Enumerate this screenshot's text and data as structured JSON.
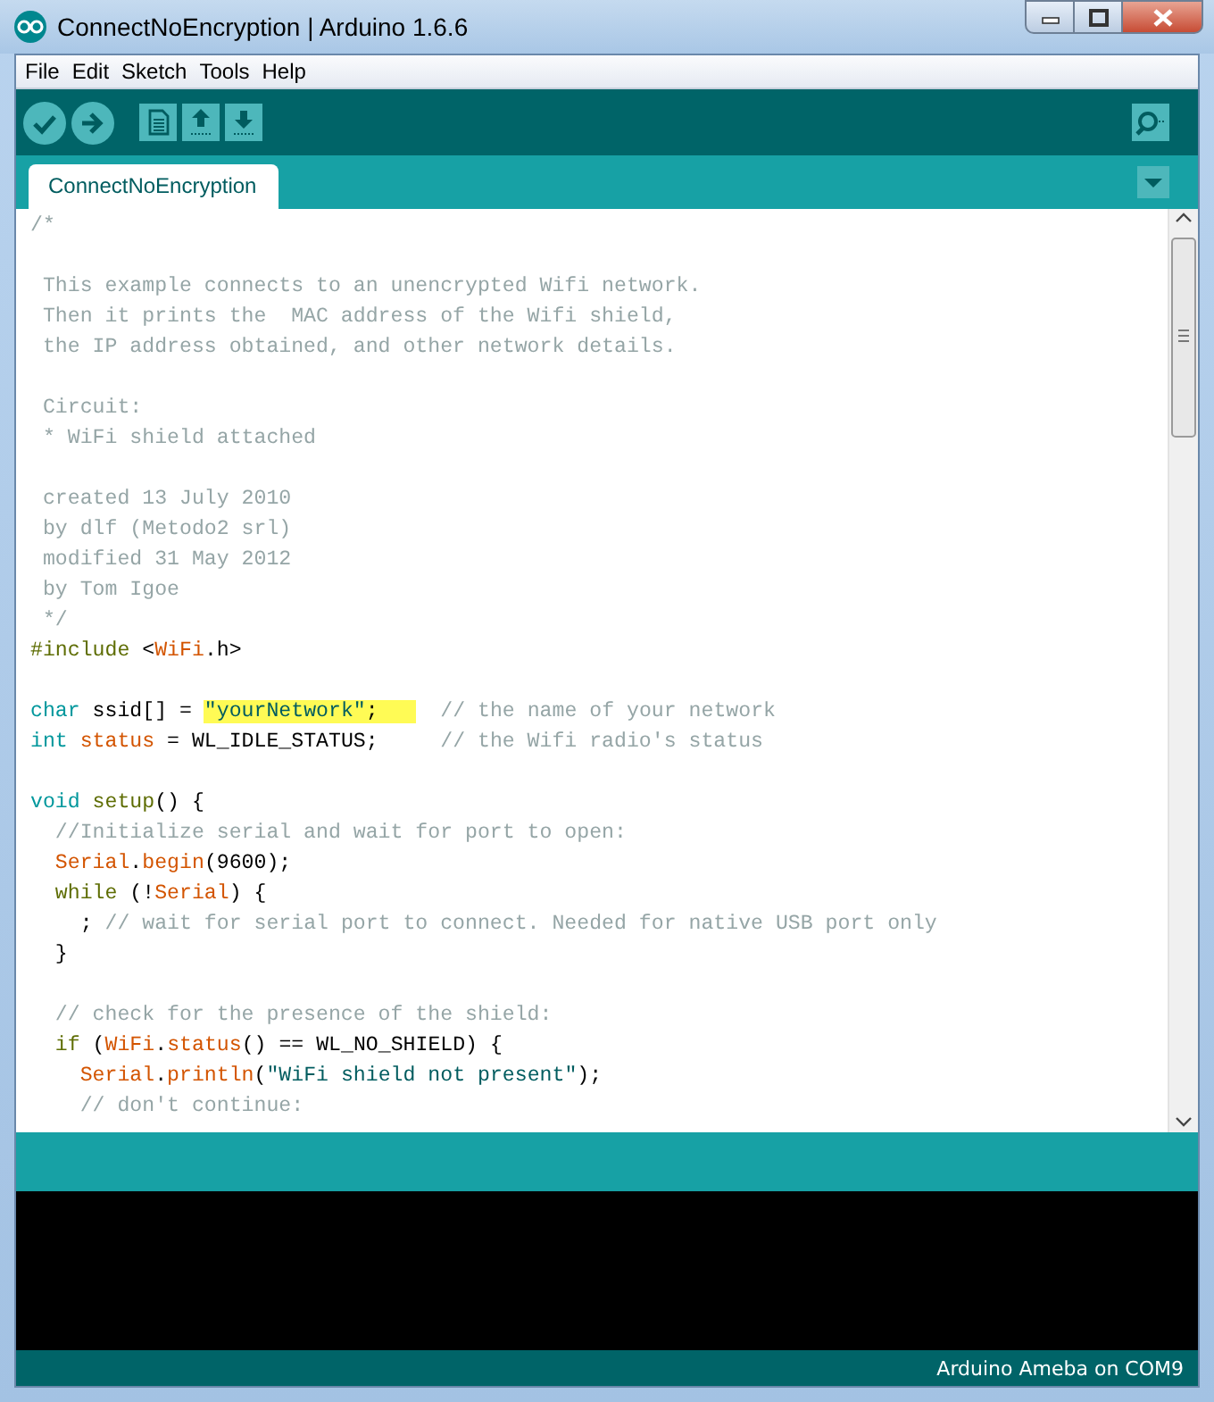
{
  "window": {
    "title": "ConnectNoEncryption | Arduino 1.6.6",
    "controls": [
      {
        "kind": "minimize"
      },
      {
        "kind": "maximize"
      },
      {
        "kind": "close"
      }
    ]
  },
  "menu": [
    "File",
    "Edit",
    "Sketch",
    "Tools",
    "Help"
  ],
  "toolbar": [
    {
      "kind": "verify"
    },
    {
      "kind": "upload"
    },
    {
      "kind": "new"
    },
    {
      "kind": "open"
    },
    {
      "kind": "save"
    },
    {
      "kind": "monitor"
    }
  ],
  "tabs": [
    {
      "label": "ConnectNoEncryption",
      "selected": true
    }
  ],
  "editor": {
    "lines": [
      {
        "kind": "code",
        "tokens": [
          {
            "kind": "comment",
            "text": "/*"
          }
        ]
      },
      {
        "kind": "blank"
      },
      {
        "kind": "code",
        "tokens": [
          {
            "kind": "comment",
            "text": " This example connects to an unencrypted Wifi network."
          }
        ]
      },
      {
        "kind": "code",
        "tokens": [
          {
            "kind": "comment",
            "text": " Then it prints the  MAC address of the Wifi shield,"
          }
        ]
      },
      {
        "kind": "code",
        "tokens": [
          {
            "kind": "comment",
            "text": " the IP address obtained, and other network details."
          }
        ]
      },
      {
        "kind": "blank"
      },
      {
        "kind": "code",
        "tokens": [
          {
            "kind": "comment",
            "text": " Circuit:"
          }
        ]
      },
      {
        "kind": "code",
        "tokens": [
          {
            "kind": "comment",
            "text": " * WiFi shield attached"
          }
        ]
      },
      {
        "kind": "blank"
      },
      {
        "kind": "code",
        "tokens": [
          {
            "kind": "comment",
            "text": " created 13 July 2010"
          }
        ]
      },
      {
        "kind": "code",
        "tokens": [
          {
            "kind": "comment",
            "text": " by dlf (Metodo2 srl)"
          }
        ]
      },
      {
        "kind": "code",
        "tokens": [
          {
            "kind": "comment",
            "text": " modified 31 May 2012"
          }
        ]
      },
      {
        "kind": "code",
        "tokens": [
          {
            "kind": "comment",
            "text": " by Tom Igoe"
          }
        ]
      },
      {
        "kind": "code",
        "tokens": [
          {
            "kind": "comment",
            "text": " */"
          }
        ]
      },
      {
        "kind": "code",
        "tokens": [
          {
            "kind": "control",
            "text": "#include"
          },
          {
            "kind": "plain",
            "text": " <"
          },
          {
            "kind": "library",
            "text": "WiFi"
          },
          {
            "kind": "plain",
            "text": ".h>"
          }
        ]
      },
      {
        "kind": "blank"
      },
      {
        "kind": "code",
        "tokens": [
          {
            "kind": "type",
            "text": "char"
          },
          {
            "kind": "plain",
            "text": " ssid[] = "
          },
          {
            "kind": "string",
            "text": "\"yourNetwork\"",
            "highlighted": true
          },
          {
            "kind": "plain",
            "text": ";   ",
            "highlighted": true
          },
          {
            "kind": "comment",
            "text": "  // the name of your network"
          }
        ]
      },
      {
        "kind": "code",
        "tokens": [
          {
            "kind": "type",
            "text": "int"
          },
          {
            "kind": "library",
            "text": " status"
          },
          {
            "kind": "plain",
            "text": " = WL_IDLE_STATUS;     "
          },
          {
            "kind": "comment",
            "text": "// the Wifi radio's status"
          }
        ]
      },
      {
        "kind": "blank"
      },
      {
        "kind": "code",
        "tokens": [
          {
            "kind": "type",
            "text": "void"
          },
          {
            "kind": "control",
            "text": " setup"
          },
          {
            "kind": "plain",
            "text": "() {"
          }
        ]
      },
      {
        "kind": "code",
        "tokens": [
          {
            "kind": "comment",
            "text": "  //Initialize serial and wait for port to open:"
          }
        ]
      },
      {
        "kind": "code",
        "tokens": [
          {
            "kind": "library",
            "text": "  Serial"
          },
          {
            "kind": "plain",
            "text": "."
          },
          {
            "kind": "library",
            "text": "begin"
          },
          {
            "kind": "plain",
            "text": "(9600);"
          }
        ]
      },
      {
        "kind": "code",
        "tokens": [
          {
            "kind": "control",
            "text": "  while"
          },
          {
            "kind": "plain",
            "text": " (!"
          },
          {
            "kind": "library",
            "text": "Serial"
          },
          {
            "kind": "plain",
            "text": ") {"
          }
        ]
      },
      {
        "kind": "code",
        "tokens": [
          {
            "kind": "plain",
            "text": "    ; "
          },
          {
            "kind": "comment",
            "text": "// wait for serial port to connect. Needed for native USB port only"
          }
        ]
      },
      {
        "kind": "code",
        "tokens": [
          {
            "kind": "plain",
            "text": "  }"
          }
        ]
      },
      {
        "kind": "blank"
      },
      {
        "kind": "code",
        "tokens": [
          {
            "kind": "comment",
            "text": "  // check for the presence of the shield:"
          }
        ]
      },
      {
        "kind": "code",
        "tokens": [
          {
            "kind": "control",
            "text": "  if"
          },
          {
            "kind": "plain",
            "text": " ("
          },
          {
            "kind": "library",
            "text": "WiFi"
          },
          {
            "kind": "plain",
            "text": "."
          },
          {
            "kind": "library",
            "text": "status"
          },
          {
            "kind": "plain",
            "text": "() == WL_NO_SHIELD) {"
          }
        ]
      },
      {
        "kind": "code",
        "tokens": [
          {
            "kind": "library",
            "text": "    Serial"
          },
          {
            "kind": "plain",
            "text": "."
          },
          {
            "kind": "library",
            "text": "println"
          },
          {
            "kind": "plain",
            "text": "("
          },
          {
            "kind": "string",
            "text": "\"WiFi shield not present\""
          },
          {
            "kind": "plain",
            "text": ");"
          }
        ]
      },
      {
        "kind": "code",
        "tokens": [
          {
            "kind": "comment",
            "text": "    // don't continue:"
          }
        ]
      }
    ]
  },
  "status_bar": {
    "board": "Arduino Ameba on COM9"
  }
}
